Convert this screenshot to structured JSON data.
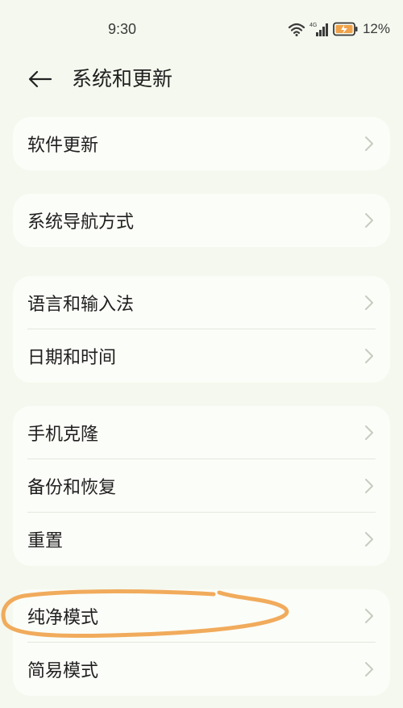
{
  "status": {
    "time": "9:30",
    "network": "4G",
    "battery": "12%"
  },
  "header": {
    "title": "系统和更新",
    "back_icon": "arrow-left-icon"
  },
  "groups": [
    {
      "items": [
        {
          "label": "软件更新"
        }
      ]
    },
    {
      "items": [
        {
          "label": "系统导航方式"
        }
      ]
    },
    {
      "items": [
        {
          "label": "语言和输入法"
        },
        {
          "label": "日期和时间"
        }
      ]
    },
    {
      "items": [
        {
          "label": "手机克隆"
        },
        {
          "label": "备份和恢复"
        },
        {
          "label": "重置"
        }
      ]
    },
    {
      "items": [
        {
          "label": "纯净模式"
        },
        {
          "label": "简易模式"
        }
      ]
    }
  ],
  "colors": {
    "background": "#f4f8ee",
    "card": "#fbfdf8",
    "annotation": "#f0a24a"
  }
}
